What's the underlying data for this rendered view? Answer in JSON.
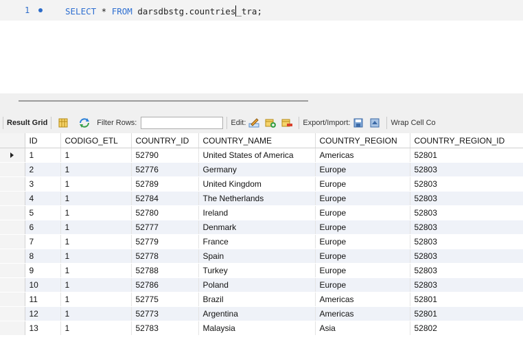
{
  "editor": {
    "line_number": "1",
    "sql_keyword_1": "SELECT",
    "sql_star": " * ",
    "sql_keyword_2": "FROM",
    "sql_table_before_caret": " darsdbstg.countries",
    "sql_table_after_caret": "_tra;"
  },
  "toolbar": {
    "result_grid": "Result Grid",
    "filter_rows": "Filter Rows:",
    "filter_value": "",
    "edit": "Edit:",
    "export_import": "Export/Import:",
    "wrap_cell": "Wrap Cell Co"
  },
  "grid": {
    "columns": [
      "ID",
      "CODIGO_ETL",
      "COUNTRY_ID",
      "COUNTRY_NAME",
      "COUNTRY_REGION",
      "COUNTRY_REGION_ID"
    ],
    "rows": [
      [
        "1",
        "1",
        "52790",
        "United States of America",
        "Americas",
        "52801"
      ],
      [
        "2",
        "1",
        "52776",
        "Germany",
        "Europe",
        "52803"
      ],
      [
        "3",
        "1",
        "52789",
        "United Kingdom",
        "Europe",
        "52803"
      ],
      [
        "4",
        "1",
        "52784",
        "The Netherlands",
        "Europe",
        "52803"
      ],
      [
        "5",
        "1",
        "52780",
        "Ireland",
        "Europe",
        "52803"
      ],
      [
        "6",
        "1",
        "52777",
        "Denmark",
        "Europe",
        "52803"
      ],
      [
        "7",
        "1",
        "52779",
        "France",
        "Europe",
        "52803"
      ],
      [
        "8",
        "1",
        "52778",
        "Spain",
        "Europe",
        "52803"
      ],
      [
        "9",
        "1",
        "52788",
        "Turkey",
        "Europe",
        "52803"
      ],
      [
        "10",
        "1",
        "52786",
        "Poland",
        "Europe",
        "52803"
      ],
      [
        "11",
        "1",
        "52775",
        "Brazil",
        "Americas",
        "52801"
      ],
      [
        "12",
        "1",
        "52773",
        "Argentina",
        "Americas",
        "52801"
      ],
      [
        "13",
        "1",
        "52783",
        "Malaysia",
        "Asia",
        "52802"
      ]
    ]
  },
  "colors": {
    "keyword": "#2e6fd1",
    "row_alt": "#eff2f8"
  }
}
